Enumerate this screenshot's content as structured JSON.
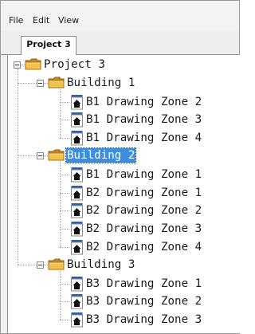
{
  "menu": {
    "file": "File",
    "edit": "Edit",
    "view": "View"
  },
  "tabs": {
    "active": "Project 3"
  },
  "tree": {
    "root": "Project 3",
    "buildings": [
      {
        "label": "Building 1",
        "selected": false,
        "zones": [
          "B1 Drawing Zone 2",
          "B1 Drawing Zone 3",
          "B1 Drawing Zone 4"
        ]
      },
      {
        "label": "Building 2",
        "selected": true,
        "zones": [
          "B1 Drawing Zone 1",
          "B2 Drawing Zone 1",
          "B2 Drawing Zone 2",
          "B2 Drawing Zone 3",
          "B2 Drawing Zone 4"
        ]
      },
      {
        "label": "Building 3",
        "selected": false,
        "zones": [
          "B3 Drawing Zone 1",
          "B3 Drawing Zone 2",
          "B3 Drawing Zone 3"
        ]
      }
    ]
  },
  "icons": {
    "folder": "folder-icon",
    "drawing": "drawing-zone-icon",
    "expander": "collapse-icon"
  },
  "colors": {
    "selection": "#3d8ee0",
    "folder": "#f0c040"
  }
}
